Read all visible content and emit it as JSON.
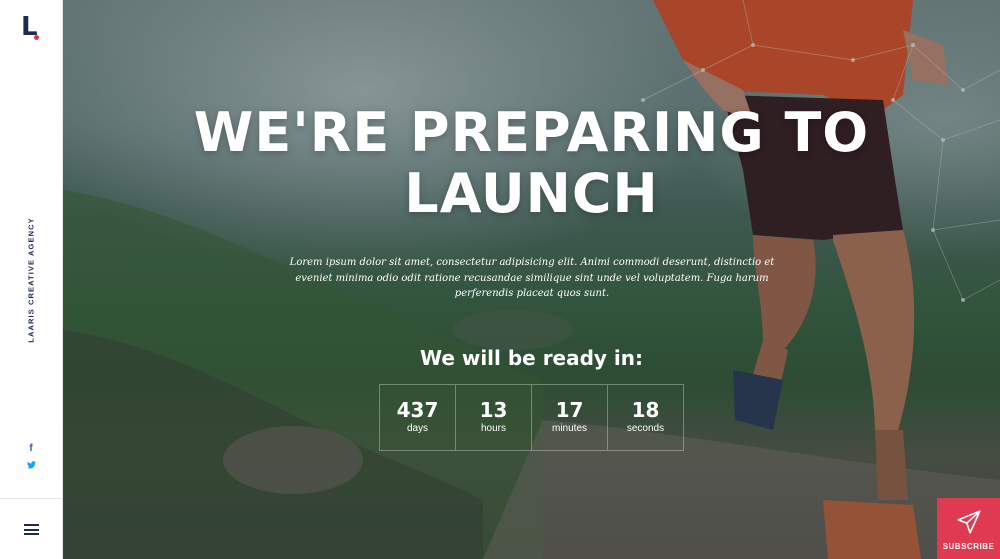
{
  "sidebar": {
    "logo_letter": "L.",
    "agency_text": "LAARIS CREATIVE AGENCY",
    "social": [
      {
        "icon": "facebook-icon",
        "glyph": "f"
      },
      {
        "icon": "twitter-icon",
        "glyph": "❧"
      }
    ],
    "menu_icon": "hamburger-menu-icon"
  },
  "hero": {
    "headline_line1": "WE'RE PREPARING TO",
    "headline_line2": "LAUNCH",
    "intro": "Lorem ipsum dolor sit amet, consectetur adipisicing elit. Animi commodi deserunt, distinctio et eveniet minima odio odit ratione recusandae similique sint unde vel voluptatem. Fuga harum perferendis placeat quos sunt.",
    "ready_text": "We will be ready in:",
    "countdown": [
      {
        "value": "437",
        "label": "days"
      },
      {
        "value": "13",
        "label": "hours"
      },
      {
        "value": "17",
        "label": "minutes"
      },
      {
        "value": "18",
        "label": "seconds"
      }
    ]
  },
  "subscribe": {
    "label": "SUBSCRIBE",
    "icon": "paper-plane-icon"
  },
  "colors": {
    "brand_navy": "#1d2b4f",
    "accent_red": "#df3a52"
  }
}
